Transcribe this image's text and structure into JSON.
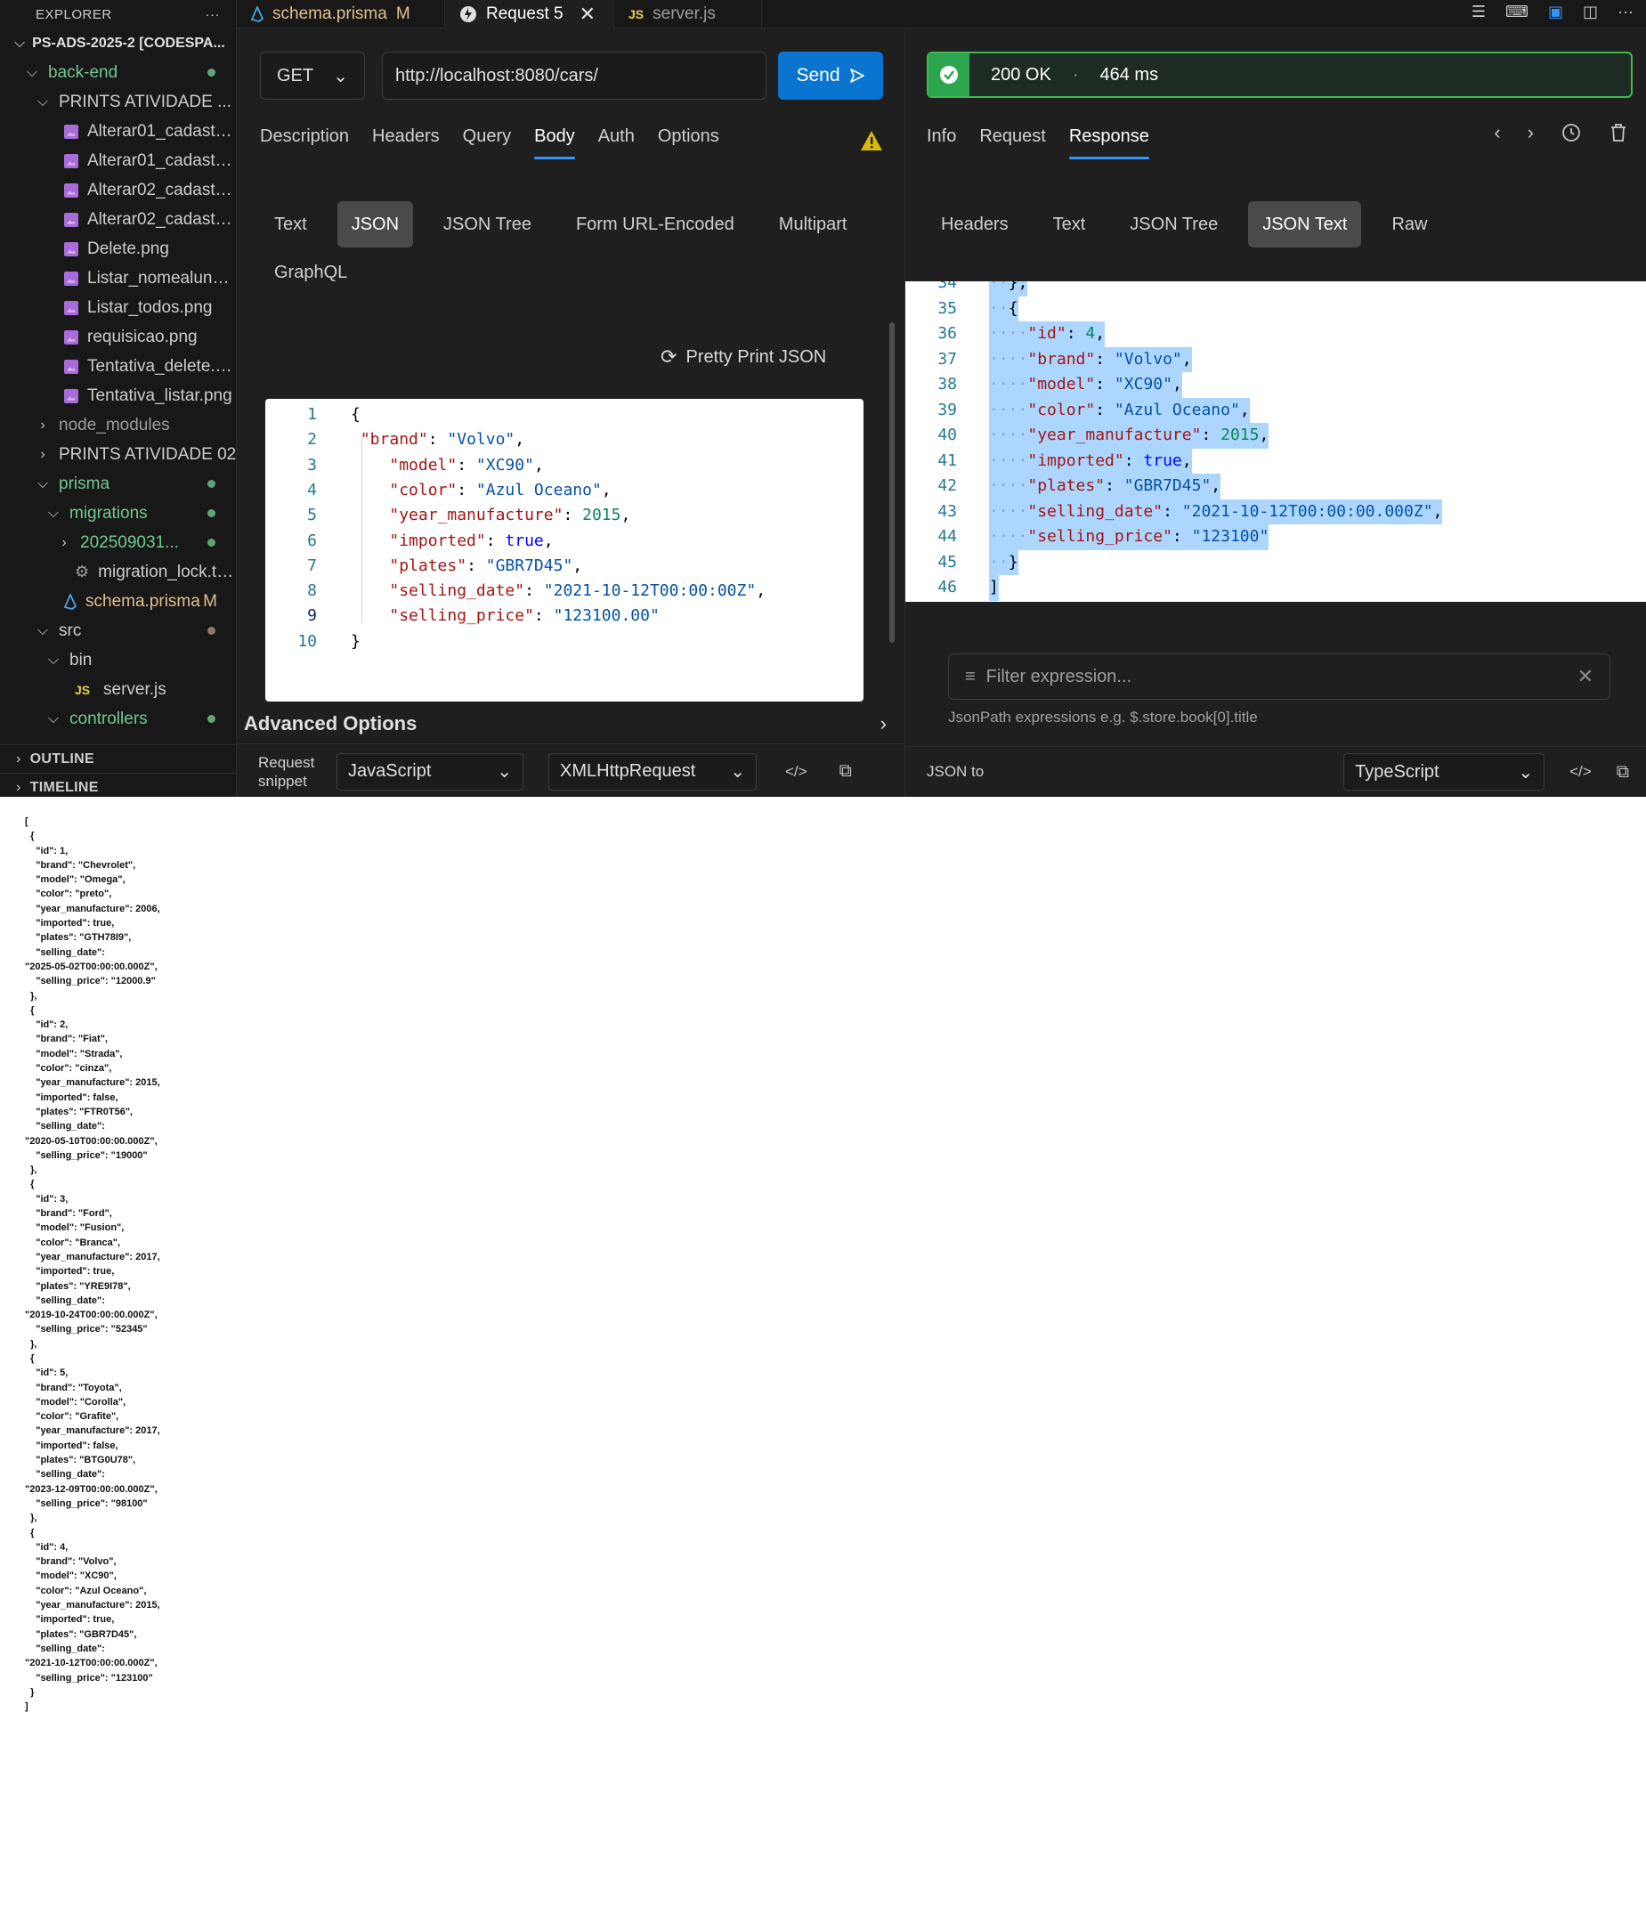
{
  "sidebar": {
    "header": "EXPLORER",
    "root": "PS-ADS-2025-2 [CODESPA...",
    "items": [
      {
        "label": "back-end",
        "depth": 1,
        "kind": "folder-open",
        "color": "green",
        "dot": "green"
      },
      {
        "label": "PRINTS ATIVIDADE ...",
        "depth": 2,
        "kind": "folder-open",
        "color": "default"
      },
      {
        "label": "Alterar01_cadastro...",
        "depth": 3,
        "kind": "image"
      },
      {
        "label": "Alterar01_cadastro...",
        "depth": 3,
        "kind": "image"
      },
      {
        "label": "Alterar02_cadastro...",
        "depth": 3,
        "kind": "image"
      },
      {
        "label": "Alterar02_cadastro...",
        "depth": 3,
        "kind": "image"
      },
      {
        "label": "Delete.png",
        "depth": 3,
        "kind": "image"
      },
      {
        "label": "Listar_nomealuno....",
        "depth": 3,
        "kind": "image"
      },
      {
        "label": "Listar_todos.png",
        "depth": 3,
        "kind": "image"
      },
      {
        "label": "requisicao.png",
        "depth": 3,
        "kind": "image"
      },
      {
        "label": "Tentativa_delete.png",
        "depth": 3,
        "kind": "image"
      },
      {
        "label": "Tentativa_listar.png",
        "depth": 3,
        "kind": "image"
      },
      {
        "label": "node_modules",
        "depth": 2,
        "kind": "folder-closed",
        "color": "dim"
      },
      {
        "label": "PRINTS ATIVIDADE 02",
        "depth": 2,
        "kind": "folder-closed",
        "color": "default"
      },
      {
        "label": "prisma",
        "depth": 2,
        "kind": "folder-open",
        "color": "green",
        "dot": "green"
      },
      {
        "label": "migrations",
        "depth": 3,
        "kind": "folder-open",
        "color": "green",
        "dot": "green"
      },
      {
        "label": "202509031...",
        "depth": 4,
        "kind": "folder-closed",
        "color": "green",
        "dot": "green"
      },
      {
        "label": "migration_lock.to...",
        "depth": 4,
        "kind": "gear"
      },
      {
        "label": "schema.prisma",
        "depth": 3,
        "kind": "prisma",
        "color": "yellow",
        "badge": "M"
      },
      {
        "label": "src",
        "depth": 2,
        "kind": "folder-open",
        "color": "default",
        "dot": "brown"
      },
      {
        "label": "bin",
        "depth": 3,
        "kind": "folder-open",
        "color": "default"
      },
      {
        "label": "server.js",
        "depth": 4,
        "kind": "js"
      },
      {
        "label": "controllers",
        "depth": 3,
        "kind": "folder-open",
        "color": "green",
        "dot": "green"
      }
    ],
    "sections": [
      "OUTLINE",
      "TIMELINE"
    ]
  },
  "tabs": [
    {
      "label": "schema.prisma",
      "modified": "M",
      "icon": "prisma-icon",
      "active": false
    },
    {
      "label": "Request 5",
      "icon": "thunder-client-icon",
      "active": true
    },
    {
      "label": "server.js",
      "icon": "js-icon",
      "active": false
    }
  ],
  "request": {
    "method": "GET",
    "url": "http://localhost:8080/cars/",
    "send_label": "Send",
    "tabs": [
      "Description",
      "Headers",
      "Query",
      "Body",
      "Auth",
      "Options"
    ],
    "active_tab": "Body",
    "body_types": [
      "Text",
      "JSON",
      "JSON Tree",
      "Form URL-Encoded",
      "Multipart",
      "GraphQL"
    ],
    "active_body_type": "JSON",
    "pretty_print_label": "Pretty Print JSON",
    "body_lines": [
      "{",
      " \"brand\": \"Volvo\",",
      "    \"model\": \"XC90\",",
      "    \"color\": \"Azul Oceano\",",
      "    \"year_manufacture\": 2015,",
      "    \"imported\": true,",
      "    \"plates\": \"GBR7D45\",",
      "    \"selling_date\": \"2021-10-12T00:00:00Z\",",
      "    \"selling_price\": \"123100.00\"",
      "}"
    ],
    "active_line": 9,
    "advanced_options_label": "Advanced Options",
    "snippet_label": "Request snippet",
    "snippet_language": "JavaScript",
    "snippet_client": "XMLHttpRequest"
  },
  "response": {
    "status": "200 OK",
    "time": "464 ms",
    "separator": "·",
    "tabs": [
      "Info",
      "Request",
      "Response"
    ],
    "active_tab": "Response",
    "view_tabs": [
      "Headers",
      "Text",
      "JSON Tree",
      "JSON Text",
      "Raw"
    ],
    "active_view_tab": "JSON Text",
    "start_line_number": 34,
    "lines": [
      "  },",
      "  {",
      "    \"id\": 4,",
      "    \"brand\": \"Volvo\",",
      "    \"model\": \"XC90\",",
      "    \"color\": \"Azul Oceano\",",
      "    \"year_manufacture\": 2015,",
      "    \"imported\": true,",
      "    \"plates\": \"GBR7D45\",",
      "    \"selling_date\": \"2021-10-12T00:00:00.000Z\",",
      "    \"selling_price\": \"123100\"",
      "  }",
      "]"
    ],
    "filter_placeholder": "Filter expression...",
    "filter_hint": "JsonPath expressions e.g. $.store.book[0].title",
    "json_to_label": "JSON to",
    "json_to_language": "TypeScript"
  },
  "raw_output": "[\n  {\n    \"id\": 1,\n    \"brand\": \"Chevrolet\",\n    \"model\": \"Omega\",\n    \"color\": \"preto\",\n    \"year_manufacture\": 2006,\n    \"imported\": true,\n    \"plates\": \"GTH78I9\",\n    \"selling_date\":\n\"2025-05-02T00:00:00.000Z\",\n    \"selling_price\": \"12000.9\"\n  },\n  {\n    \"id\": 2,\n    \"brand\": \"Fiat\",\n    \"model\": \"Strada\",\n    \"color\": \"cinza\",\n    \"year_manufacture\": 2015,\n    \"imported\": false,\n    \"plates\": \"FTR0T56\",\n    \"selling_date\":\n\"2020-05-10T00:00:00.000Z\",\n    \"selling_price\": \"19000\"\n  },\n  {\n    \"id\": 3,\n    \"brand\": \"Ford\",\n    \"model\": \"Fusion\",\n    \"color\": \"Branca\",\n    \"year_manufacture\": 2017,\n    \"imported\": true,\n    \"plates\": \"YRE9I78\",\n    \"selling_date\":\n\"2019-10-24T00:00:00.000Z\",\n    \"selling_price\": \"52345\"\n  },\n  {\n    \"id\": 5,\n    \"brand\": \"Toyota\",\n    \"model\": \"Corolla\",\n    \"color\": \"Grafite\",\n    \"year_manufacture\": 2017,\n    \"imported\": false,\n    \"plates\": \"BTG0U78\",\n    \"selling_date\":\n\"2023-12-09T00:00:00.000Z\",\n    \"selling_price\": \"98100\"\n  },\n  {\n    \"id\": 4,\n    \"brand\": \"Volvo\",\n    \"model\": \"XC90\",\n    \"color\": \"Azul Oceano\",\n    \"year_manufacture\": 2015,\n    \"imported\": true,\n    \"plates\": \"GBR7D45\",\n    \"selling_date\":\n\"2021-10-12T00:00:00.000Z\",\n    \"selling_price\": \"123100\"\n  }\n]",
  "colors": {
    "accent": "#0b74d1",
    "status_ok": "#3fb950",
    "modified": "#e2c08d",
    "git_added": "#73c991"
  }
}
